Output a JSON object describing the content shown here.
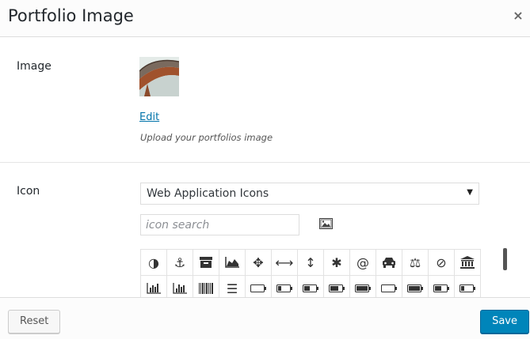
{
  "header": {
    "title": "Portfolio Image",
    "close_glyph": "×"
  },
  "image_section": {
    "label": "Image",
    "edit_link": "Edit",
    "help": "Upload your portfolios image"
  },
  "icon_section": {
    "label": "Icon",
    "select_value": "Web Application Icons",
    "select_arrow": "▼",
    "search_placeholder": "icon search",
    "row1": [
      {
        "name": "adjust-icon",
        "glyph": "◑"
      },
      {
        "name": "anchor-icon",
        "glyph": "⚓"
      },
      {
        "name": "archive-icon",
        "glyph": ""
      },
      {
        "name": "area-chart-icon",
        "glyph": ""
      },
      {
        "name": "arrows-icon",
        "glyph": "✥"
      },
      {
        "name": "arrows-h-icon",
        "glyph": "⟷"
      },
      {
        "name": "arrows-v-icon",
        "glyph": "↕"
      },
      {
        "name": "asterisk-icon",
        "glyph": "✱"
      },
      {
        "name": "at-icon",
        "glyph": "@"
      },
      {
        "name": "automobile-icon",
        "glyph": ""
      },
      {
        "name": "balance-scale-icon",
        "glyph": "⚖"
      },
      {
        "name": "ban-icon",
        "glyph": "⊘"
      },
      {
        "name": "bank-icon",
        "glyph": ""
      }
    ],
    "row2": [
      {
        "name": "bar-chart-icon",
        "glyph": ""
      },
      {
        "name": "bar-chart-o-icon",
        "glyph": ""
      },
      {
        "name": "barcode-icon",
        "glyph": ""
      },
      {
        "name": "bars-icon",
        "glyph": "☰"
      },
      {
        "name": "battery-0-icon",
        "glyph": ""
      },
      {
        "name": "battery-1-icon",
        "glyph": ""
      },
      {
        "name": "battery-2-icon",
        "glyph": ""
      },
      {
        "name": "battery-3-icon",
        "glyph": ""
      },
      {
        "name": "battery-4-icon",
        "glyph": ""
      },
      {
        "name": "battery-empty-icon",
        "glyph": ""
      },
      {
        "name": "battery-full-icon",
        "glyph": ""
      },
      {
        "name": "battery-half-icon",
        "glyph": ""
      },
      {
        "name": "battery-quarter-icon",
        "glyph": ""
      }
    ]
  },
  "footer": {
    "reset_label": "Reset",
    "save_label": "Save"
  },
  "colors": {
    "accent": "#0085ba",
    "link": "#0073aa"
  }
}
